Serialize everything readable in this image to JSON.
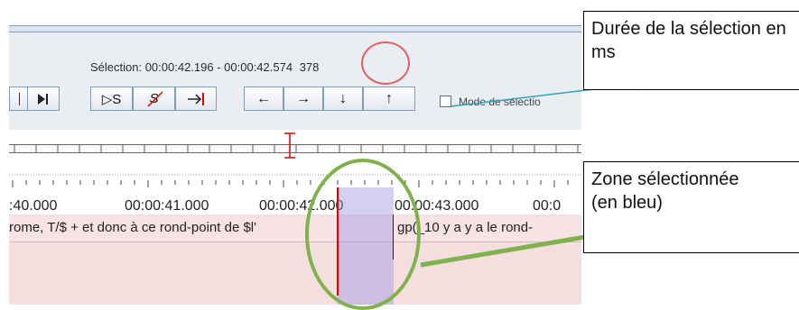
{
  "selection": {
    "label": "Sélection: 00:00:42.196 - 00:00:42.574",
    "duration_ms": "378"
  },
  "toolbar": {
    "play_pause_icon": "play-pause-icon",
    "play_selection": "▷S",
    "stop_selection": "S",
    "go_to_end": "→|",
    "left": "←",
    "right": "→",
    "down": "↓",
    "up": "↑",
    "mode_label": "Mode de sélectio"
  },
  "timeline": {
    "ticks": [
      ":40.000",
      "00:00:41.000",
      "00:00:42.000",
      "00:00:43.000",
      "00:0"
    ]
  },
  "transcript": {
    "segment_left": "rome, T/$ + et donc à ce rond-point de $l'",
    "segment_right": "gp(_10 y a y a le rond-"
  },
  "annotations": {
    "duration_callout": "Durée de la sélection en ms",
    "zone_callout": "Zone sélectionnée\n (en bleu)"
  },
  "colors": {
    "selection": "#a096e6",
    "annotation_arrow_teal": "#2fa3b4",
    "annotation_green": "#7fb24c",
    "annotation_red": "#e06060"
  }
}
